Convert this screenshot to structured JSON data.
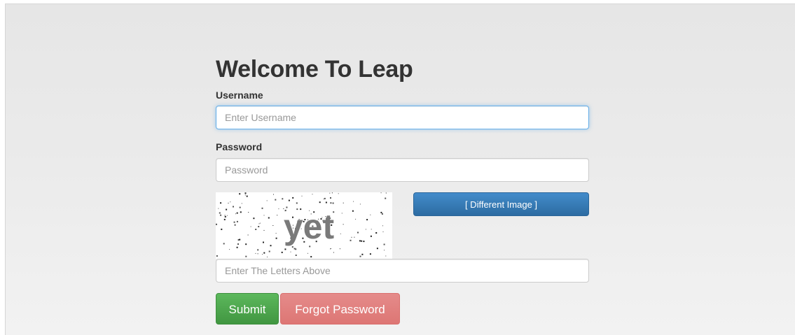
{
  "heading": "Welcome To Leap",
  "username": {
    "label": "Username",
    "placeholder": "Enter Username",
    "value": ""
  },
  "password": {
    "label": "Password",
    "placeholder": "Password",
    "value": ""
  },
  "captcha": {
    "text": "yet",
    "different_image_label": "[ Different Image ]",
    "input_placeholder": "Enter The Letters Above"
  },
  "buttons": {
    "submit": "Submit",
    "forgot_password": "Forgot Password"
  },
  "colors": {
    "primary": "#337ab7",
    "success": "#4cae4c",
    "danger_light": "#e08583",
    "focus": "#66afe9"
  }
}
